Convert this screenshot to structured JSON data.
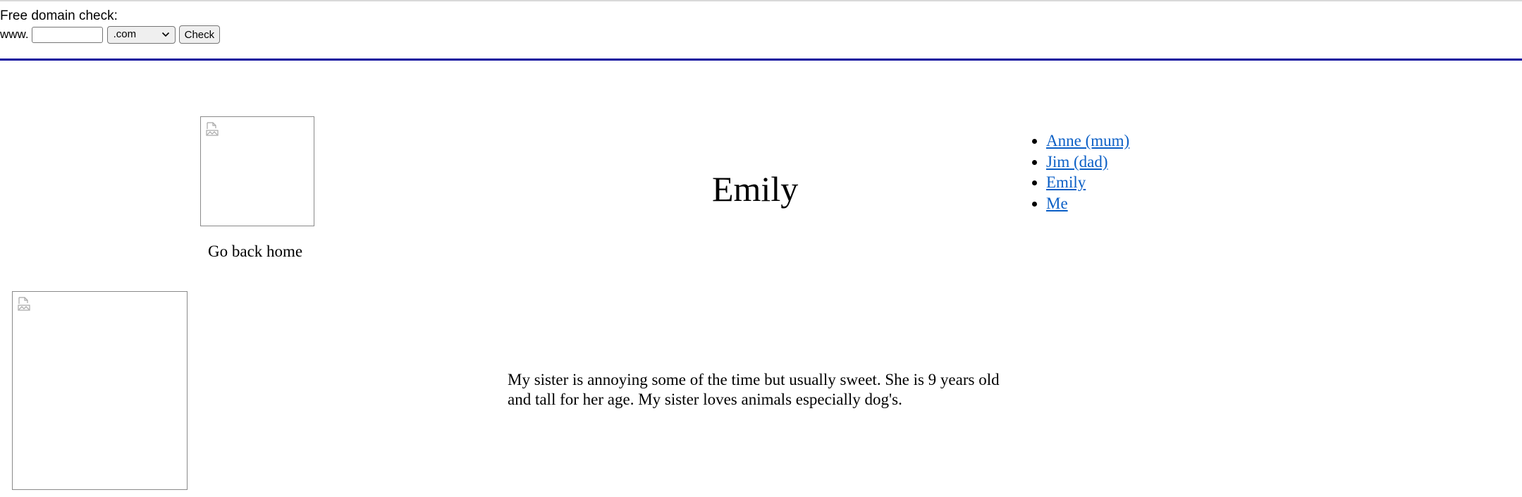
{
  "domain_check": {
    "heading": "Free domain check:",
    "prefix": "www.",
    "input_value": "",
    "tld_selected": ".com",
    "button_label": "Check"
  },
  "home_link": {
    "label": "Go back home"
  },
  "page": {
    "title": "Emily",
    "bio": "My sister is annoying some of the time but usually sweet. She is 9 years old and tall for her age. My sister loves animals especially dog's."
  },
  "nav": {
    "items": [
      {
        "label": "Anne (mum)"
      },
      {
        "label": "Jim (dad)"
      },
      {
        "label": "Emily"
      },
      {
        "label": "Me"
      }
    ]
  },
  "colors": {
    "link": "#0b5fc6",
    "divider": "#0b0b9e"
  },
  "icons": {
    "image_placeholder": "broken-image-icon",
    "select_arrow": "chevron-down-icon"
  }
}
